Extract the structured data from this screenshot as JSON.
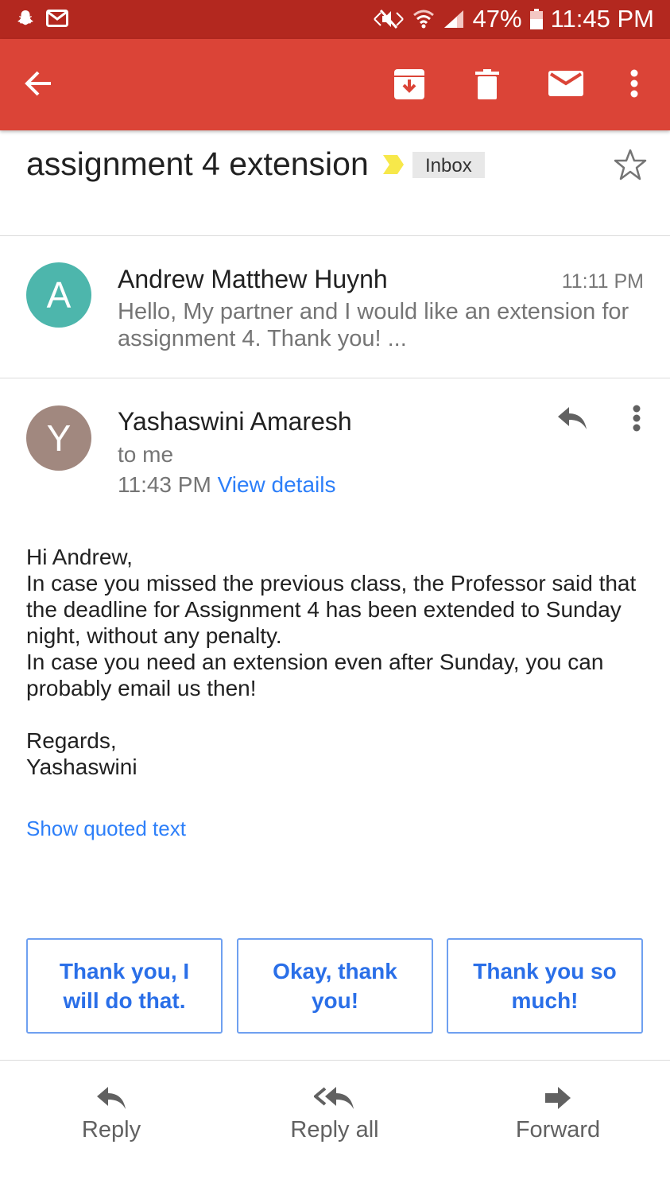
{
  "status_bar": {
    "battery": "47%",
    "time": "11:45 PM",
    "icons": [
      "snapchat-icon",
      "mail-notification-icon",
      "mute-icon",
      "wifi-icon",
      "signal-icon",
      "battery-icon"
    ]
  },
  "app_bar": {
    "icons": [
      "back-arrow-icon",
      "archive-icon",
      "delete-icon",
      "mark-unread-icon",
      "more-vert-icon"
    ]
  },
  "thread": {
    "subject": "assignment 4 extension",
    "label": "Inbox"
  },
  "messages": [
    {
      "avatar_letter": "A",
      "avatar_color": "#4db6ac",
      "sender": "Andrew Matthew Huynh",
      "time": "11:11 PM",
      "snippet": "Hello, My partner and I would like an extension for assignment 4. Thank you! ..."
    },
    {
      "avatar_letter": "Y",
      "avatar_color": "#a1887f",
      "sender": "Yashaswini Amaresh",
      "recipient": "to me",
      "time": "11:43 PM",
      "view_details": "View details",
      "body": "Hi Andrew,\nIn case you missed the previous class, the Professor said that the deadline for Assignment 4 has been extended to Sunday night, without any penalty.\nIn case you need an extension even after Sunday, you can probably email us then!\n\nRegards,\nYashaswini",
      "show_quoted": "Show quoted text"
    }
  ],
  "smart_replies": [
    "Thank you, I will do that.",
    "Okay, thank you!",
    "Thank you so much!"
  ],
  "actions": {
    "reply": "Reply",
    "reply_all": "Reply all",
    "forward": "Forward"
  },
  "colors": {
    "status_bar": "#b3281f",
    "app_bar": "#db4437",
    "link": "#2d7ff9",
    "smart_reply_border": "#6fa0f0"
  }
}
